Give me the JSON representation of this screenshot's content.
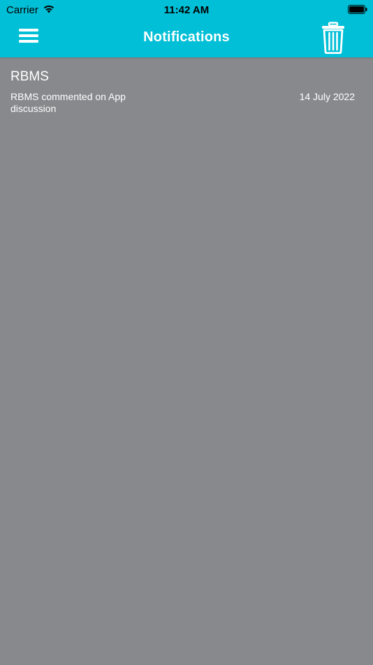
{
  "status_bar": {
    "carrier": "Carrier",
    "time": "11:42 AM",
    "wifi_icon": "wifi-icon",
    "battery_icon": "battery-icon"
  },
  "nav": {
    "title": "Notifications",
    "menu_icon": "hamburger-menu-icon",
    "delete_icon": "trash-icon",
    "bar_color": "#00bfd6"
  },
  "notifications": [
    {
      "title": "RBMS",
      "message": "RBMS commented on App discussion",
      "date": "14 July 2022"
    }
  ],
  "background_color": "#88898d"
}
